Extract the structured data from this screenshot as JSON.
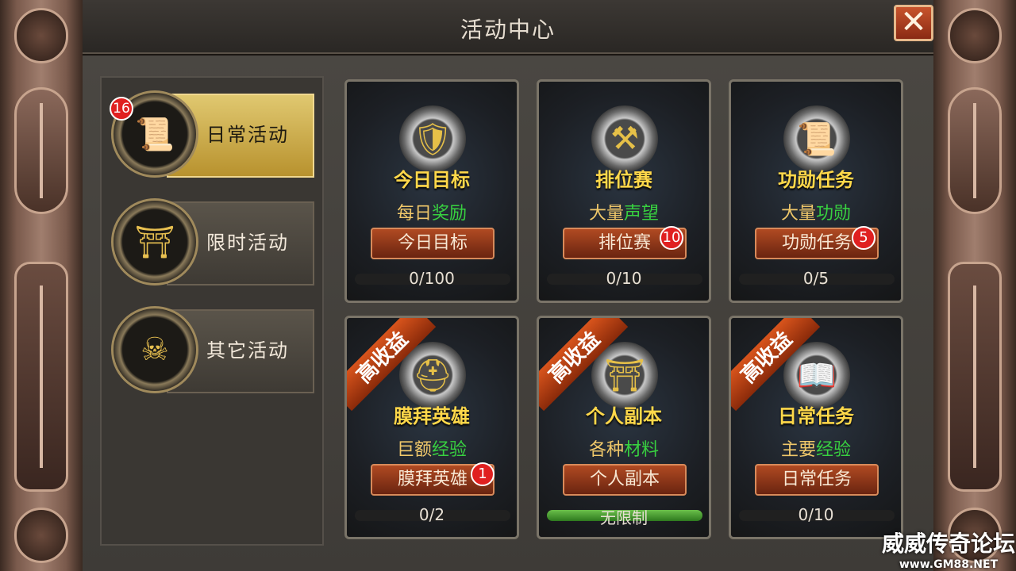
{
  "window": {
    "title": "活动中心",
    "close_label": "✕"
  },
  "sidebar": {
    "items": [
      {
        "label": "日常活动",
        "icon": "scroll-icon",
        "badge": "16",
        "active": true
      },
      {
        "label": "限时活动",
        "icon": "gate-icon",
        "badge": "",
        "active": false
      },
      {
        "label": "其它活动",
        "icon": "demon-head-icon",
        "badge": "",
        "active": false
      }
    ]
  },
  "cards": [
    {
      "name": "今日目标",
      "desc_a": "每日",
      "desc_b": "奖励",
      "action": "今日目标",
      "progress": "0/100",
      "progress_fraction": 0,
      "badge": "",
      "ribbon": "",
      "icon": "shield-icon"
    },
    {
      "name": "排位赛",
      "desc_a": "大量",
      "desc_b": "声望",
      "action": "排位赛",
      "progress": "0/10",
      "progress_fraction": 0,
      "badge": "10",
      "ribbon": "",
      "icon": "hammer-sword-icon"
    },
    {
      "name": "功勋任务",
      "desc_a": "大量",
      "desc_b": "功勋",
      "action": "功勋任务",
      "progress": "0/5",
      "progress_fraction": 0,
      "badge": "5",
      "ribbon": "",
      "icon": "scroll-icon"
    },
    {
      "name": "膜拜英雄",
      "desc_a": "巨额",
      "desc_b": "经验",
      "action": "膜拜英雄",
      "progress": "0/2",
      "progress_fraction": 0,
      "badge": "1",
      "ribbon": "高收益",
      "icon": "helmet-icon"
    },
    {
      "name": "个人副本",
      "desc_a": "各种",
      "desc_b": "材料",
      "action": "个人副本",
      "progress": "无限制",
      "progress_fraction": 1,
      "badge": "",
      "ribbon": "高收益",
      "icon": "gate-icon"
    },
    {
      "name": "日常任务",
      "desc_a": "主要",
      "desc_b": "经验",
      "action": "日常任务",
      "progress": "0/10",
      "progress_fraction": 0,
      "badge": "",
      "ribbon": "高收益",
      "icon": "book-icon"
    }
  ],
  "watermark": {
    "text": "威威传奇论坛",
    "url": "www.GM88.NET"
  },
  "colors": {
    "accent_gold": "#ffd84a",
    "highlight_green": "#38d040",
    "badge_red": "#e02020"
  }
}
